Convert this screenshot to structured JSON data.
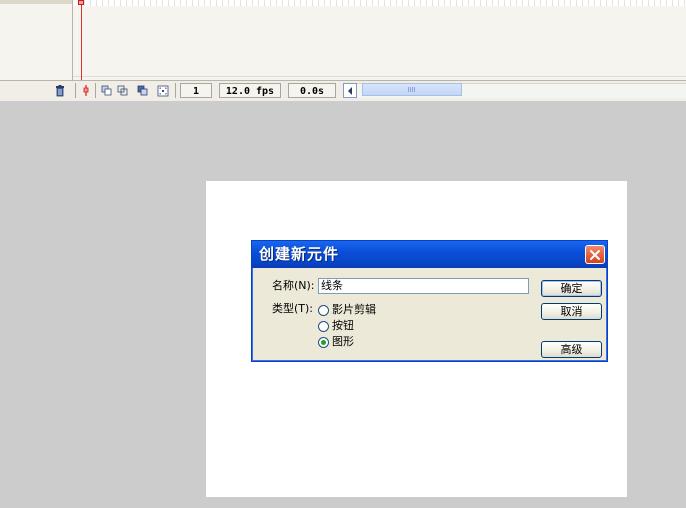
{
  "timeline": {
    "current_frame": "1",
    "frame_rate": "12.0 fps",
    "elapsed_time": "0.0s"
  },
  "dialog": {
    "title": "创建新元件",
    "name_label": "名称(N):",
    "name_value": "线条",
    "type_label": "类型(T):",
    "type_options": [
      "影片剪辑",
      "按钮",
      "图形"
    ],
    "selected_type": "图形",
    "ok_label": "确定",
    "cancel_label": "取消",
    "advanced_label": "高级"
  },
  "colors": {
    "title_bar": "#0a4fd8",
    "stage": "#cccccc",
    "canvas": "#ffffff",
    "playhead": "#e03030"
  }
}
